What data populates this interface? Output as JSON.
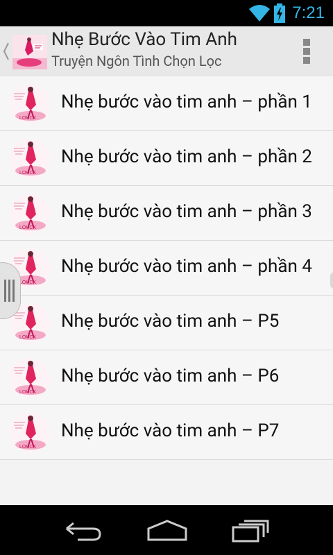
{
  "status_bar": {
    "time": "7:21",
    "accent_color": "#33b5e5"
  },
  "action_bar": {
    "title": "Nhẹ Bước Vào Tim Anh",
    "subtitle": "Truyện Ngôn Tình Chọn Lọc"
  },
  "chapters": [
    {
      "label": "Nhẹ bước vào tim anh – phần 1"
    },
    {
      "label": "Nhẹ bước vào tim anh – phần 2"
    },
    {
      "label": "Nhẹ bước vào tim anh – phần 3"
    },
    {
      "label": "Nhẹ bước vào tim anh – phần 4"
    },
    {
      "label": "Nhẹ bước vào tim anh – P5"
    },
    {
      "label": "Nhẹ bước vào tim anh – P6"
    },
    {
      "label": "Nhẹ bước vào tim anh – P7"
    }
  ],
  "icons": {
    "status": [
      "wifi-icon",
      "battery-charging-icon"
    ],
    "action_bar": [
      "back-chevron-icon",
      "app-cover-icon",
      "overflow-menu-icon"
    ],
    "navigation": [
      "back-icon",
      "home-icon",
      "recent-apps-icon"
    ]
  }
}
